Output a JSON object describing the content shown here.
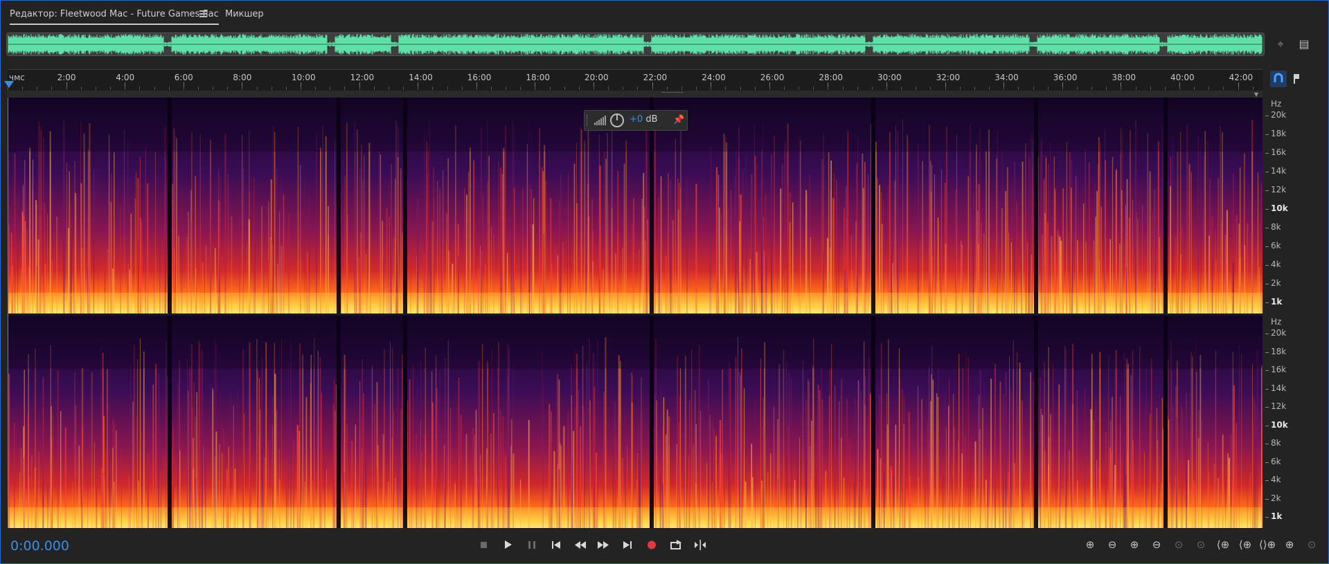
{
  "tabs": [
    {
      "label": "Редактор: Fleetwood Mac - Future Games.flac",
      "active": true
    },
    {
      "label": "Микшер",
      "active": false
    }
  ],
  "ruler": {
    "unit_label": "чмс",
    "ticks": [
      "2:00",
      "4:00",
      "6:00",
      "8:00",
      "10:00",
      "12:00",
      "14:00",
      "16:00",
      "18:00",
      "20:00",
      "22:00",
      "24:00",
      "26:00",
      "28:00",
      "30:00",
      "32:00",
      "34:00",
      "36:00",
      "38:00",
      "40:00",
      "42:00"
    ]
  },
  "frequency_axis": {
    "unit": "Hz",
    "labels": [
      "20k",
      "18k",
      "16k",
      "14k",
      "12k",
      "10k",
      "8k",
      "6k",
      "4k",
      "2k",
      "1k"
    ],
    "bold": [
      "10k",
      "1k"
    ]
  },
  "hud": {
    "gain_sign": "+0",
    "gain_unit": "dB"
  },
  "status": {
    "time": "0:00.000"
  },
  "colors": {
    "accent": "#3a8ee6",
    "waveform": "#5fe0a8",
    "record": "#e23a3a",
    "spectrum_low": "#1a0830",
    "spectrum_mid": "#c0203a",
    "spectrum_high": "#ffd84a"
  },
  "icons": {
    "transport": [
      "stop-icon",
      "play-icon",
      "pause-icon",
      "skip-to-start-icon",
      "rewind-icon",
      "fast-forward-icon",
      "skip-to-end-icon",
      "record-icon",
      "loop-output-icon",
      "skip-selection-icon"
    ],
    "zoom": [
      "zoom-in-amplitude-icon",
      "zoom-out-amplitude-icon",
      "zoom-in-time-icon",
      "zoom-out-time-icon",
      "zoom-reset-icon",
      "zoom-in-selection-icon",
      "zoom-to-left-icon",
      "zoom-to-right-icon",
      "zoom-to-selection-icon",
      "zoom-full-icon",
      "zoom-all-icon"
    ]
  }
}
